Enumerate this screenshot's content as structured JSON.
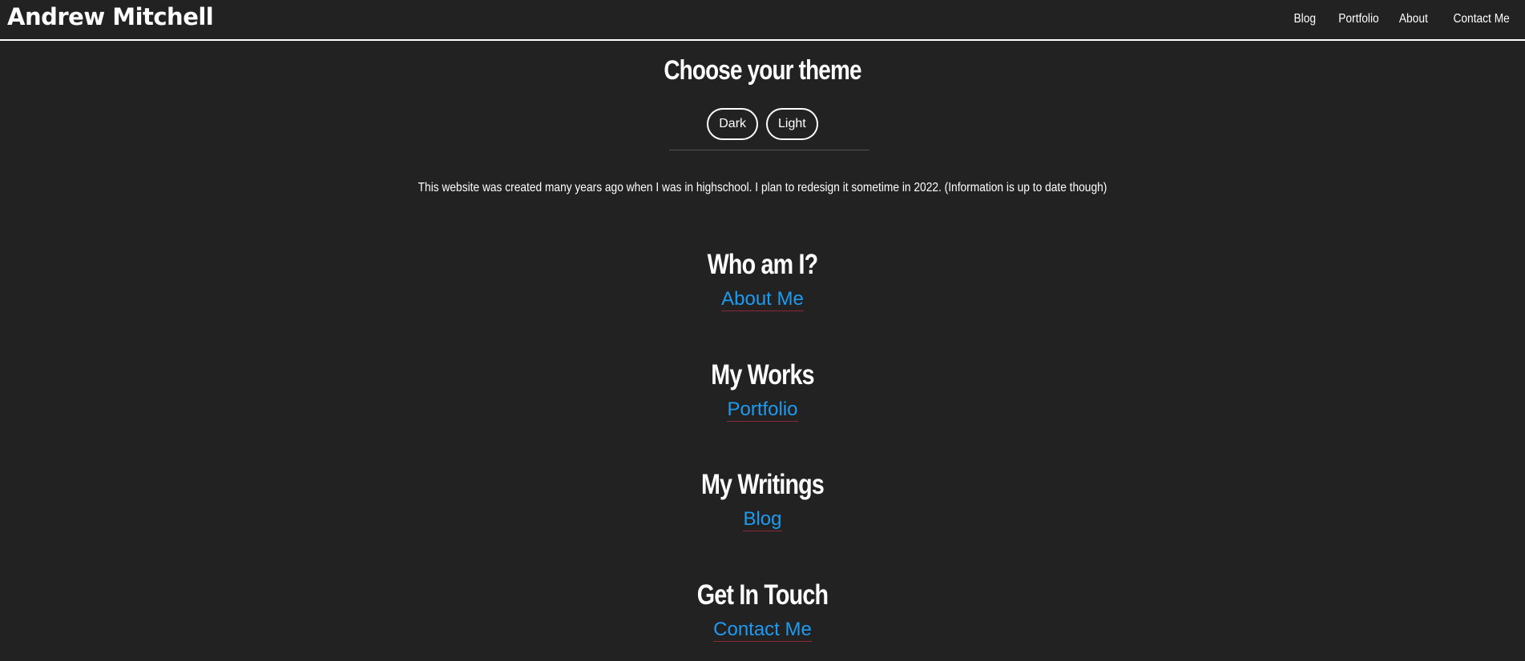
{
  "header": {
    "brand": "Andrew Mitchell",
    "nav": [
      "Blog",
      "Portfolio",
      "About",
      "Contact Me"
    ]
  },
  "theme": {
    "title": "Choose your theme",
    "buttons": [
      "Dark",
      "Light"
    ]
  },
  "notice": "This website was created many years ago when I was in highschool. I plan to redesign it sometime in 2022. (Information is up to date though)",
  "sections": [
    {
      "heading": "Who am I?",
      "link": "About Me"
    },
    {
      "heading": "My Works",
      "link": "Portfolio"
    },
    {
      "heading": "My Writings",
      "link": "Blog"
    },
    {
      "heading": "Get In Touch",
      "link": "Contact Me"
    }
  ],
  "colors": {
    "background": "#222222",
    "text": "#ffffff",
    "link": "#1e9bf0",
    "link_underline": "#8a2b3a"
  }
}
